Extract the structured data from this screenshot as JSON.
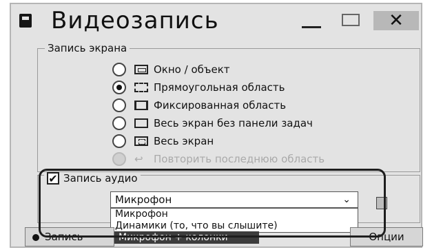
{
  "window": {
    "title": "Видеозапись",
    "close_glyph": "✕"
  },
  "screen_group": {
    "legend": "Запись экрана",
    "options": [
      {
        "label": "Окно / объект",
        "checked": false,
        "disabled": false
      },
      {
        "label": "Прямоугольная область",
        "checked": true,
        "disabled": false
      },
      {
        "label": "Фиксированная область",
        "checked": false,
        "disabled": false
      },
      {
        "label": "Весь экран без панели задач",
        "checked": false,
        "disabled": false
      },
      {
        "label": "Весь экран",
        "checked": false,
        "disabled": false
      },
      {
        "label": "Повторить последнюю область",
        "checked": false,
        "disabled": true
      }
    ]
  },
  "audio_group": {
    "checkbox_label": "Запись аудио",
    "checked": true,
    "check_glyph": "✔",
    "selected_value": "Микрофон",
    "dropdown_options": [
      "Микрофон",
      "Динамики (то, что вы слышите)",
      "Микрофон + колонки"
    ],
    "highlighted_option": "Микрофон + колонки"
  },
  "bottom": {
    "record_label": "Запись",
    "options_label": "Опции"
  }
}
